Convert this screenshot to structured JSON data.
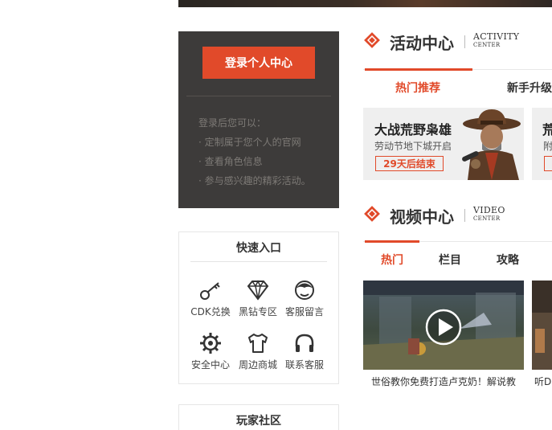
{
  "login": {
    "button_label": "登录个人中心",
    "lines": [
      "登录后您可以：",
      "· 定制属于您个人的官网",
      "· 查看角色信息",
      "· 参与感兴趣的精彩活动。"
    ]
  },
  "quick_entry": {
    "title": "快速入口",
    "items": [
      {
        "label": "CDK兑换",
        "icon": "key-icon"
      },
      {
        "label": "黑钻专区",
        "icon": "diamond-icon"
      },
      {
        "label": "客服留言",
        "icon": "support-avatar-icon"
      },
      {
        "label": "安全中心",
        "icon": "gear-icon"
      },
      {
        "label": "周边商城",
        "icon": "tshirt-icon"
      },
      {
        "label": "联系客服",
        "icon": "headphones-icon"
      }
    ]
  },
  "community": {
    "title": "玩家社区"
  },
  "activity": {
    "title": "活动中心",
    "en_line1": "ACTIVITY",
    "en_line2": "CENTER",
    "tabs": [
      "热门推荐",
      "新手升级"
    ],
    "cards": [
      {
        "title": "大战荒野枭雄",
        "subtitle": "劳动节地下城开启",
        "badge": "29天后结束"
      },
      {
        "title": "荒",
        "subtitle": "附",
        "badge": ""
      }
    ]
  },
  "video": {
    "title": "视频中心",
    "en_line1": "VIDEO",
    "en_line2": "CENTER",
    "tabs": [
      "热门",
      "栏目",
      "攻略"
    ],
    "items": [
      {
        "caption": "世俗教你免费打造卢克奶！解说教"
      },
      {
        "caption": "听D"
      }
    ]
  },
  "colors": {
    "accent": "#e14a2a",
    "panel_dark": "#3d3b3a"
  }
}
